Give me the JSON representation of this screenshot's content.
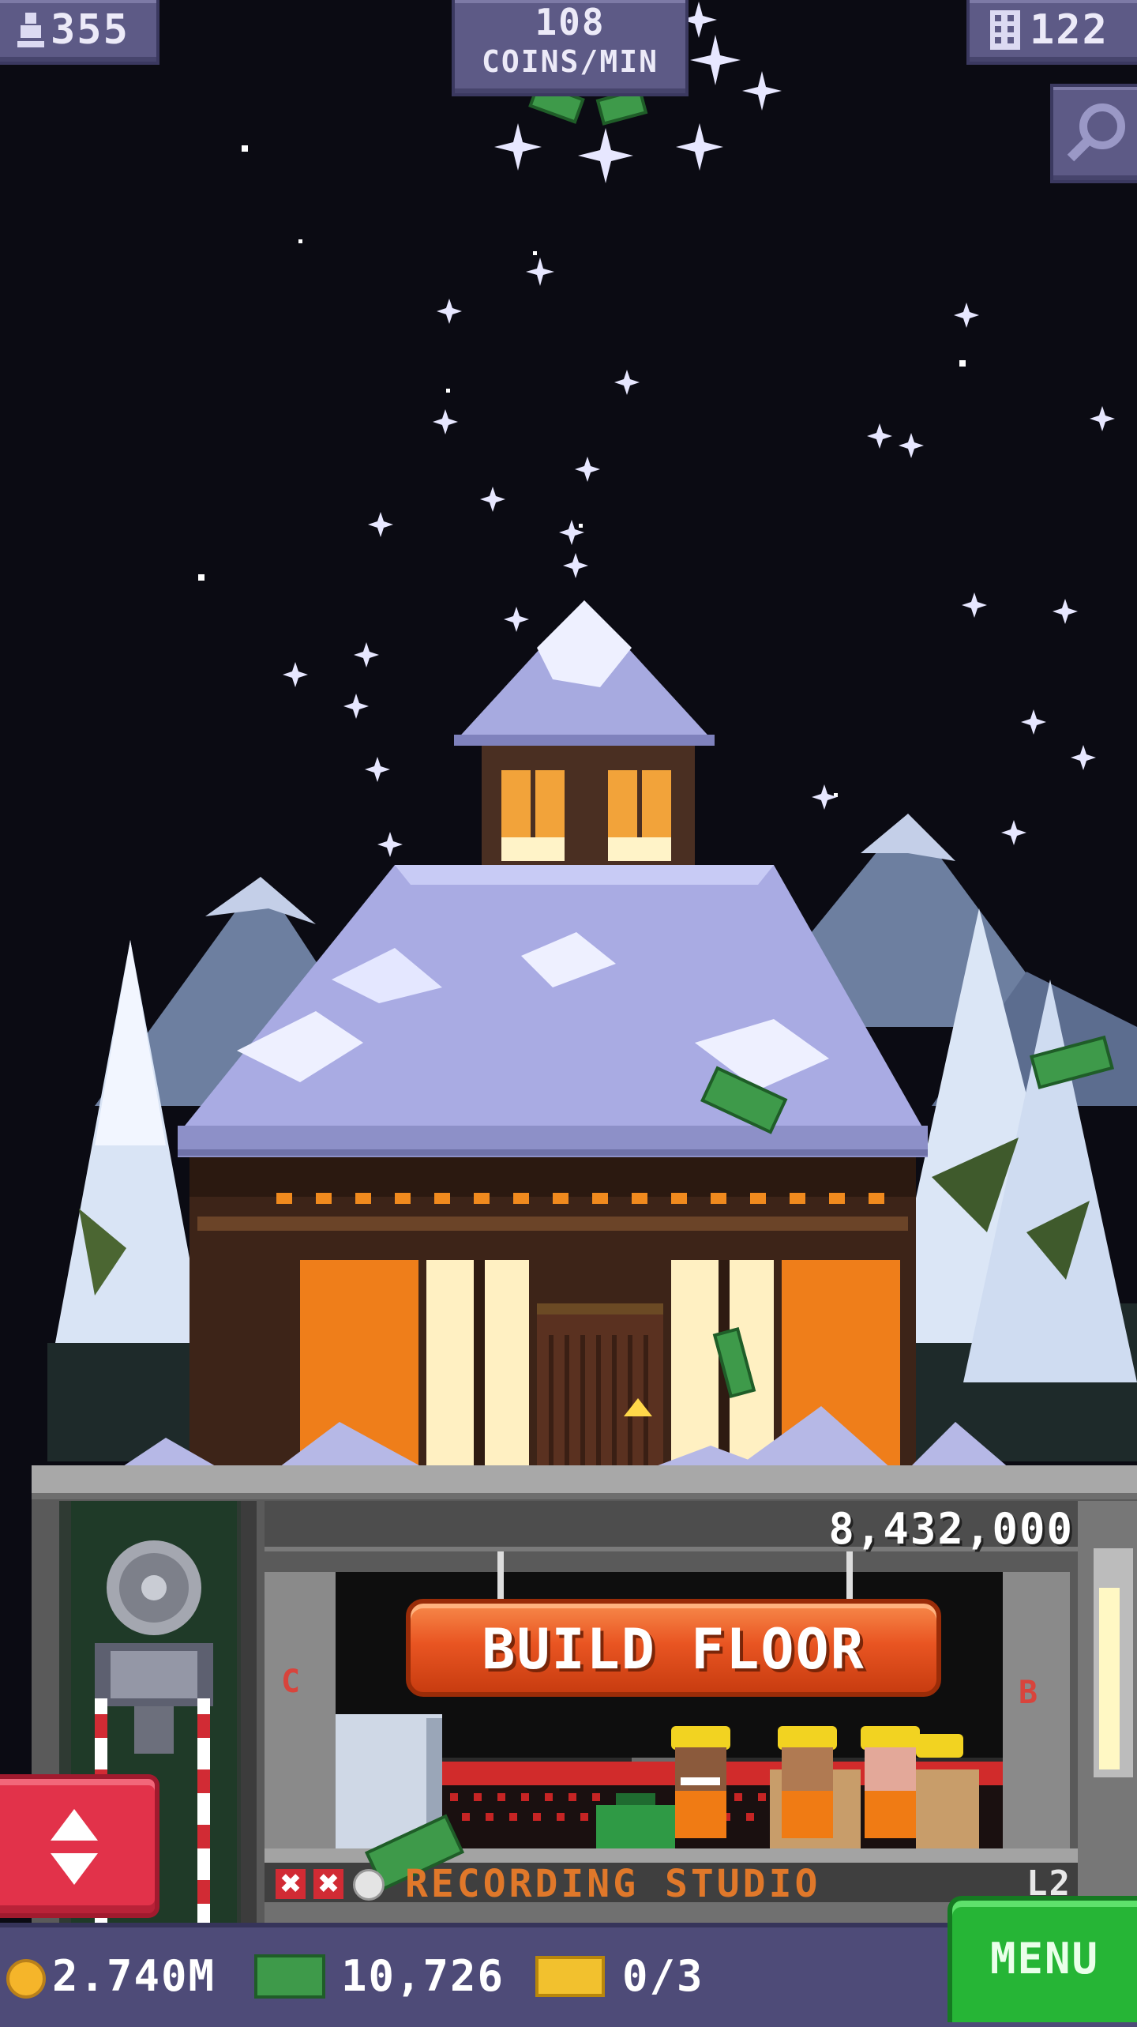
{
  "hud": {
    "population": "355",
    "rate_value": "108",
    "rate_label": "COINS/MIN",
    "floors": "122"
  },
  "floor": {
    "cost": "8,432,000",
    "build_label": "BUILD FLOOR",
    "name": "RECORDING STUDIO",
    "level": "L2",
    "letter_left": "C",
    "letter_right": "B"
  },
  "bottom": {
    "coins": "2.740M",
    "bux": "10,726",
    "tickets": "0/3",
    "menu_label": "MENU"
  },
  "icons": [
    "person-icon",
    "building-icon",
    "magnifier-icon",
    "elevator-arrows-icon",
    "coin-icon",
    "bux-icon",
    "ticket-icon",
    "x-icon",
    "clock-icon"
  ],
  "colors": {
    "sky": "#0b0b13",
    "hud": "#5d5a86",
    "build_button": "#e95522",
    "menu_button": "#26b536",
    "elevator_button": "#e2324a",
    "snow": "#b7b8e6"
  }
}
